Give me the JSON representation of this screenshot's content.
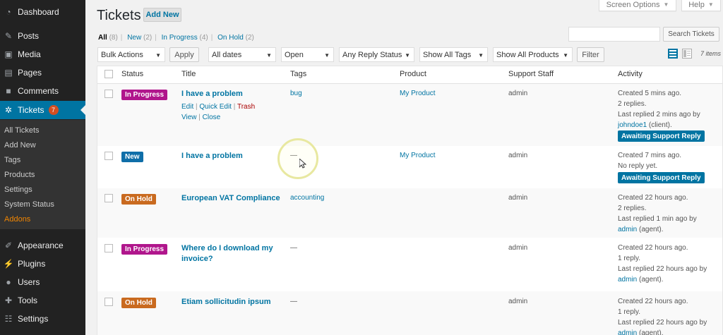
{
  "sidebar": {
    "menu_top": [
      {
        "label": "Dashboard",
        "icon": "dashboard-icon"
      }
    ],
    "menu_mid": [
      {
        "label": "Posts",
        "icon": "pin-icon"
      },
      {
        "label": "Media",
        "icon": "media-icon"
      },
      {
        "label": "Pages",
        "icon": "pages-icon"
      },
      {
        "label": "Comments",
        "icon": "comments-icon"
      }
    ],
    "tickets": {
      "label": "Tickets",
      "count": "7",
      "icon": "lifebuoy-icon"
    },
    "submenu": [
      "All Tickets",
      "Add New",
      "Tags",
      "Products",
      "Settings",
      "System Status",
      "Addons"
    ],
    "menu_bottom": [
      {
        "label": "Appearance",
        "icon": "brush-icon"
      },
      {
        "label": "Plugins",
        "icon": "plugin-icon"
      },
      {
        "label": "Users",
        "icon": "users-icon"
      },
      {
        "label": "Tools",
        "icon": "wrench-icon"
      },
      {
        "label": "Settings",
        "icon": "settings-icon"
      }
    ]
  },
  "header": {
    "title": "Tickets",
    "add_new": "Add New",
    "screen_options": "Screen Options",
    "help": "Help"
  },
  "filters_links": {
    "all": "All",
    "all_count": "(8)",
    "new": "New",
    "new_count": "(2)",
    "in_progress": "In Progress",
    "in_progress_count": "(4)",
    "on_hold": "On Hold",
    "on_hold_count": "(2)"
  },
  "search": {
    "button": "Search Tickets",
    "placeholder": ""
  },
  "toolbar": {
    "bulk_actions": "Bulk Actions",
    "apply": "Apply",
    "dates": "All dates",
    "state": "Open",
    "reply_status": "Any Reply Status",
    "tags": "Show All Tags",
    "products": "Show All Products",
    "filter": "Filter",
    "items": "7 items"
  },
  "table": {
    "columns": [
      "Status",
      "Title",
      "Tags",
      "Product",
      "Support Staff",
      "Activity"
    ],
    "row_actions": {
      "edit": "Edit",
      "quick_edit": "Quick Edit",
      "trash": "Trash",
      "view": "View",
      "close": "Close"
    },
    "rows": [
      {
        "status": "In Progress",
        "title": "I have a problem",
        "tags": "bug",
        "product": "My Product",
        "staff": "admin",
        "activity": [
          "Created 5 mins ago.",
          "2 replies.",
          "Last replied 2 mins ago by"
        ],
        "activity_by": "johndoe1",
        "activity_role": " (client).",
        "badge": "Awaiting Support Reply"
      },
      {
        "status": "New",
        "title": "I have a problem",
        "tags": "—",
        "product": "My Product",
        "staff": "admin",
        "activity": [
          "Created 7 mins ago.",
          "No reply yet."
        ],
        "badge": "Awaiting Support Reply"
      },
      {
        "status": "On Hold",
        "title": "European VAT Compliance",
        "tags": "accounting",
        "product": "",
        "staff": "admin",
        "activity": [
          "Created 22 hours ago.",
          "2 replies.",
          "Last replied 1 min ago by"
        ],
        "activity_by": "admin",
        "activity_role": " (agent)."
      },
      {
        "status": "In Progress",
        "title_lines": [
          "Where do I download my",
          "invoice?"
        ],
        "tags": "—",
        "product": "",
        "staff": "admin",
        "activity": [
          "Created 22 hours ago.",
          "1 reply.",
          "Last replied 22 hours ago by"
        ],
        "activity_by": "admin",
        "activity_role": " (agent)."
      },
      {
        "status": "On Hold",
        "title": "Etiam sollicitudin ipsum",
        "tags": "—",
        "product": "",
        "staff": "admin",
        "activity": [
          "Created 22 hours ago.",
          "1 reply.",
          "Last replied 22 hours ago by"
        ],
        "activity_by": "admin",
        "activity_role": " (agent)."
      }
    ]
  },
  "colors": {
    "in_progress": "#b0168c",
    "new": "#0f6ea8",
    "on_hold": "#c96a1f",
    "accent": "#0074a2",
    "sidebar": "#222222"
  }
}
